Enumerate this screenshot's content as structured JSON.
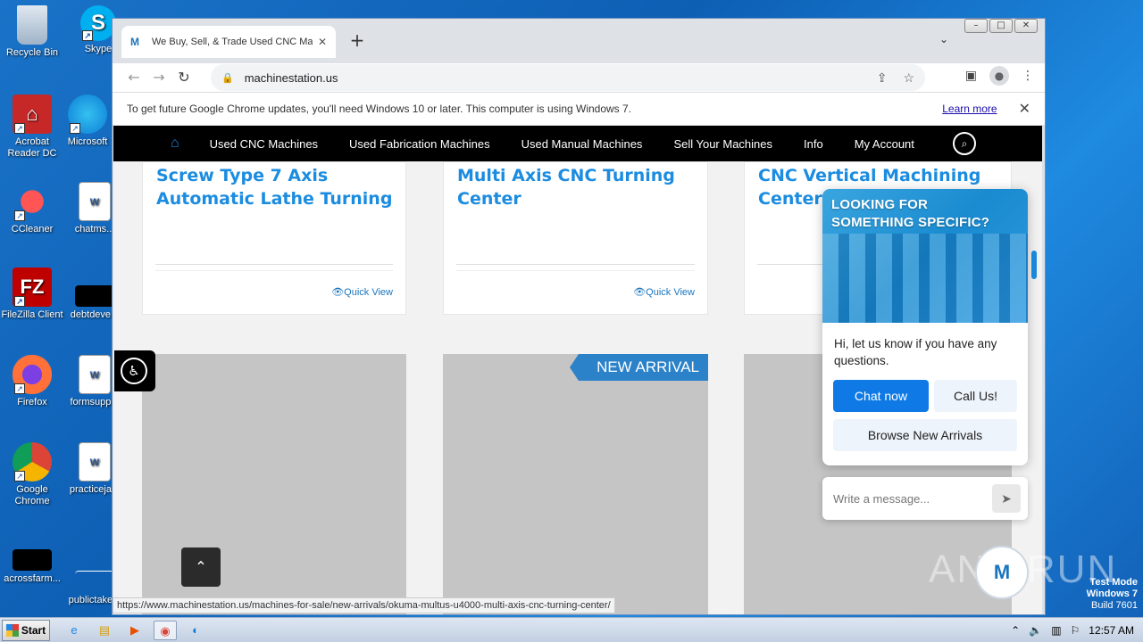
{
  "desktop": {
    "icons": [
      {
        "label": "Recycle Bin"
      },
      {
        "label": "Skype"
      },
      {
        "label": "Acrobat Reader DC"
      },
      {
        "label": "Microsoft"
      },
      {
        "label": "CCleaner"
      },
      {
        "label": "chatms..."
      },
      {
        "label": "FileZilla Client"
      },
      {
        "label": "debtdeve..."
      },
      {
        "label": "Firefox"
      },
      {
        "label": "formsupp..."
      },
      {
        "label": "Google Chrome"
      },
      {
        "label": "practiceja..."
      },
      {
        "label": "acrossfarm..."
      },
      {
        "label": "publictake..."
      }
    ]
  },
  "browser": {
    "tab_title": "We Buy, Sell, & Trade Used CNC Ma",
    "url": "machinestation.us",
    "infobar_text": "To get future Google Chrome updates, you'll need Windows 10 or later. This computer is using Windows 7.",
    "infobar_link": "Learn more",
    "status_url": "https://www.machinestation.us/machines-for-sale/new-arrivals/okuma-multus-u4000-multi-axis-cnc-turning-center/"
  },
  "site": {
    "nav": [
      "Used CNC Machines",
      "Used Fabrication Machines",
      "Used Manual Machines",
      "Sell Your Machines",
      "Info",
      "My Account"
    ],
    "cards": [
      {
        "title": "Screw Type 7 Axis Automatic Lathe Turning",
        "quick_view": "Quick View"
      },
      {
        "title": "Multi Axis CNC Turning Center",
        "quick_view": "Quick View"
      },
      {
        "title": "CNC Vertical Machining Center"
      }
    ],
    "ribbon": "NEW ARRIVAL"
  },
  "chat": {
    "headline_1": "LOOKING FOR",
    "headline_2": "SOMETHING SPECIFIC?",
    "message": "Hi, let us know if you have any questions.",
    "chat_now": "Chat now",
    "call_us": "Call Us!",
    "browse": "Browse New Arrivals",
    "input_placeholder": "Write a message..."
  },
  "watermark": "ANY RUN",
  "os": {
    "test_mode": "Test Mode",
    "os_name": "Windows 7",
    "build": "Build 7601",
    "start": "Start",
    "clock": "12:57 AM"
  }
}
